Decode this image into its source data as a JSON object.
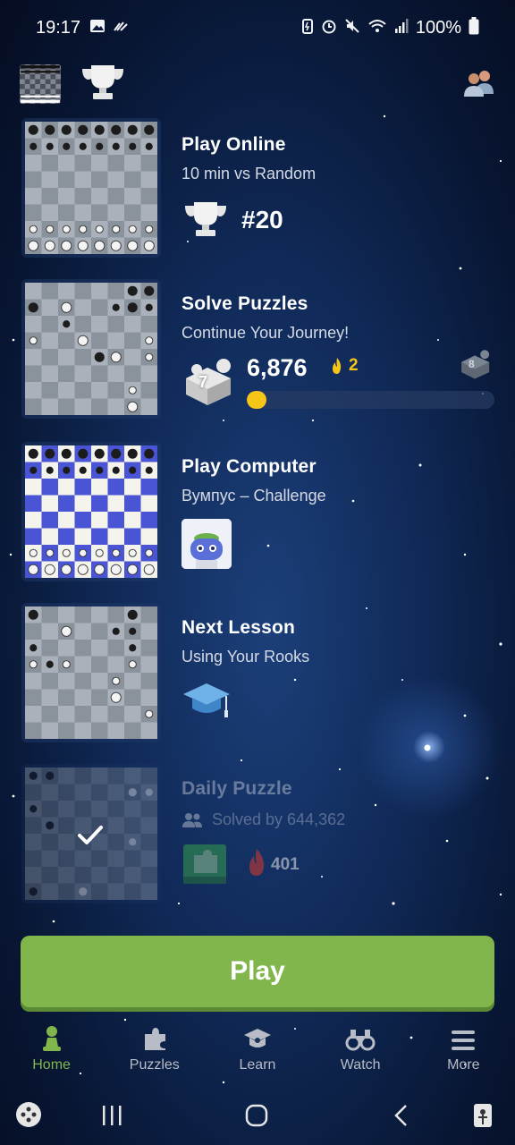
{
  "status_bar": {
    "time": "19:17",
    "battery": "100%"
  },
  "cards": [
    {
      "title": "Play Online",
      "subtitle": "10 min vs Random",
      "rank": "#20"
    },
    {
      "title": "Solve Puzzles",
      "subtitle": "Continue Your Journey!",
      "badge_level": "7",
      "rating": "6,876",
      "streak": "2",
      "next_badge_level": "8",
      "progress_percent": 8
    },
    {
      "title": "Play Computer",
      "subtitle": "Вумпус – Challenge"
    },
    {
      "title": "Next Lesson",
      "subtitle": "Using Your Rooks"
    },
    {
      "title": "Daily Puzzle",
      "subtitle": "Solved by 644,362",
      "streak": "401"
    }
  ],
  "play_button": {
    "label": "Play"
  },
  "bottom_nav": [
    {
      "label": "Home",
      "icon": "pawn-icon",
      "active": true
    },
    {
      "label": "Puzzles",
      "icon": "puzzle-icon",
      "active": false
    },
    {
      "label": "Learn",
      "icon": "graduation-cap-icon",
      "active": false
    },
    {
      "label": "Watch",
      "icon": "binoculars-icon",
      "active": false
    },
    {
      "label": "More",
      "icon": "menu-icon",
      "active": false
    }
  ],
  "colors": {
    "accent_green": "#81b64c",
    "streak_yellow": "#f5c518",
    "daily_red": "#d93a2b"
  }
}
